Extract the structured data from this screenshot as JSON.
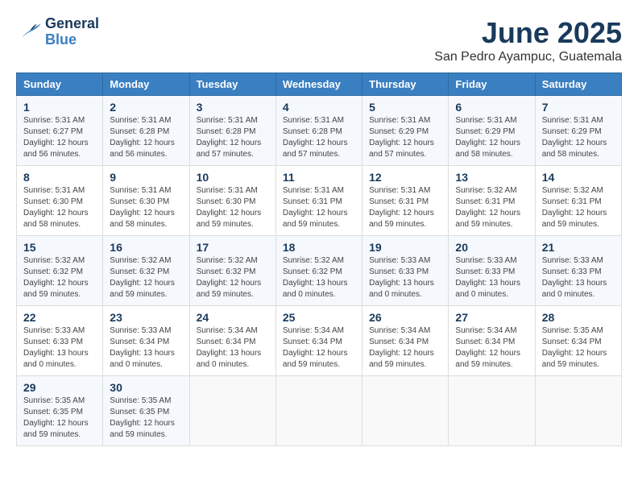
{
  "logo": {
    "line1": "General",
    "line2": "Blue"
  },
  "title": "June 2025",
  "subtitle": "San Pedro Ayampuc, Guatemala",
  "days_of_week": [
    "Sunday",
    "Monday",
    "Tuesday",
    "Wednesday",
    "Thursday",
    "Friday",
    "Saturday"
  ],
  "weeks": [
    [
      {
        "day": "1",
        "sunrise": "5:31 AM",
        "sunset": "6:27 PM",
        "daylight": "12 hours and 56 minutes."
      },
      {
        "day": "2",
        "sunrise": "5:31 AM",
        "sunset": "6:28 PM",
        "daylight": "12 hours and 56 minutes."
      },
      {
        "day": "3",
        "sunrise": "5:31 AM",
        "sunset": "6:28 PM",
        "daylight": "12 hours and 57 minutes."
      },
      {
        "day": "4",
        "sunrise": "5:31 AM",
        "sunset": "6:28 PM",
        "daylight": "12 hours and 57 minutes."
      },
      {
        "day": "5",
        "sunrise": "5:31 AM",
        "sunset": "6:29 PM",
        "daylight": "12 hours and 57 minutes."
      },
      {
        "day": "6",
        "sunrise": "5:31 AM",
        "sunset": "6:29 PM",
        "daylight": "12 hours and 58 minutes."
      },
      {
        "day": "7",
        "sunrise": "5:31 AM",
        "sunset": "6:29 PM",
        "daylight": "12 hours and 58 minutes."
      }
    ],
    [
      {
        "day": "8",
        "sunrise": "5:31 AM",
        "sunset": "6:30 PM",
        "daylight": "12 hours and 58 minutes."
      },
      {
        "day": "9",
        "sunrise": "5:31 AM",
        "sunset": "6:30 PM",
        "daylight": "12 hours and 58 minutes."
      },
      {
        "day": "10",
        "sunrise": "5:31 AM",
        "sunset": "6:30 PM",
        "daylight": "12 hours and 59 minutes."
      },
      {
        "day": "11",
        "sunrise": "5:31 AM",
        "sunset": "6:31 PM",
        "daylight": "12 hours and 59 minutes."
      },
      {
        "day": "12",
        "sunrise": "5:31 AM",
        "sunset": "6:31 PM",
        "daylight": "12 hours and 59 minutes."
      },
      {
        "day": "13",
        "sunrise": "5:32 AM",
        "sunset": "6:31 PM",
        "daylight": "12 hours and 59 minutes."
      },
      {
        "day": "14",
        "sunrise": "5:32 AM",
        "sunset": "6:31 PM",
        "daylight": "12 hours and 59 minutes."
      }
    ],
    [
      {
        "day": "15",
        "sunrise": "5:32 AM",
        "sunset": "6:32 PM",
        "daylight": "12 hours and 59 minutes."
      },
      {
        "day": "16",
        "sunrise": "5:32 AM",
        "sunset": "6:32 PM",
        "daylight": "12 hours and 59 minutes."
      },
      {
        "day": "17",
        "sunrise": "5:32 AM",
        "sunset": "6:32 PM",
        "daylight": "12 hours and 59 minutes."
      },
      {
        "day": "18",
        "sunrise": "5:32 AM",
        "sunset": "6:32 PM",
        "daylight": "13 hours and 0 minutes."
      },
      {
        "day": "19",
        "sunrise": "5:33 AM",
        "sunset": "6:33 PM",
        "daylight": "13 hours and 0 minutes."
      },
      {
        "day": "20",
        "sunrise": "5:33 AM",
        "sunset": "6:33 PM",
        "daylight": "13 hours and 0 minutes."
      },
      {
        "day": "21",
        "sunrise": "5:33 AM",
        "sunset": "6:33 PM",
        "daylight": "13 hours and 0 minutes."
      }
    ],
    [
      {
        "day": "22",
        "sunrise": "5:33 AM",
        "sunset": "6:33 PM",
        "daylight": "13 hours and 0 minutes."
      },
      {
        "day": "23",
        "sunrise": "5:33 AM",
        "sunset": "6:34 PM",
        "daylight": "13 hours and 0 minutes."
      },
      {
        "day": "24",
        "sunrise": "5:34 AM",
        "sunset": "6:34 PM",
        "daylight": "13 hours and 0 minutes."
      },
      {
        "day": "25",
        "sunrise": "5:34 AM",
        "sunset": "6:34 PM",
        "daylight": "12 hours and 59 minutes."
      },
      {
        "day": "26",
        "sunrise": "5:34 AM",
        "sunset": "6:34 PM",
        "daylight": "12 hours and 59 minutes."
      },
      {
        "day": "27",
        "sunrise": "5:34 AM",
        "sunset": "6:34 PM",
        "daylight": "12 hours and 59 minutes."
      },
      {
        "day": "28",
        "sunrise": "5:35 AM",
        "sunset": "6:34 PM",
        "daylight": "12 hours and 59 minutes."
      }
    ],
    [
      {
        "day": "29",
        "sunrise": "5:35 AM",
        "sunset": "6:35 PM",
        "daylight": "12 hours and 59 minutes."
      },
      {
        "day": "30",
        "sunrise": "5:35 AM",
        "sunset": "6:35 PM",
        "daylight": "12 hours and 59 minutes."
      },
      null,
      null,
      null,
      null,
      null
    ]
  ]
}
